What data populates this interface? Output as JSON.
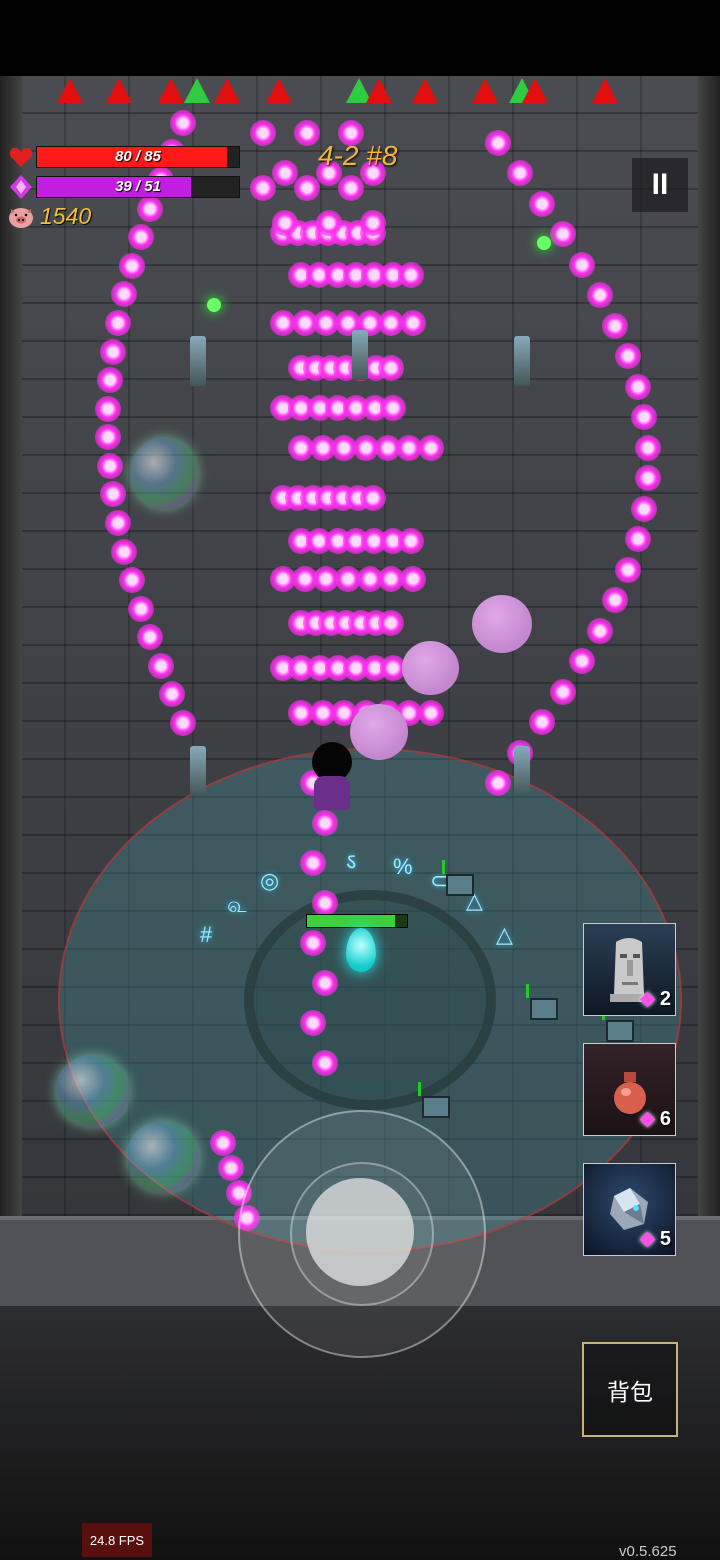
{
  "hud": {
    "hp": {
      "current": 80,
      "max": 85,
      "text": "80 / 85",
      "color": "#ff1a1a"
    },
    "mana": {
      "current": 39,
      "max": 51,
      "text": "39 / 51",
      "color": "#c21ee0"
    },
    "coins": "1540"
  },
  "level": {
    "label": "4-2 #8"
  },
  "pause": {
    "label": "II"
  },
  "skills": [
    {
      "name": "moai-statue",
      "cost": "2"
    },
    {
      "name": "red-potion-vase",
      "cost": "6"
    },
    {
      "name": "crystal-orb",
      "cost": "5"
    }
  ],
  "backpack": {
    "label": "背包"
  },
  "debug": {
    "fps": "24.8 FPS",
    "version": "v0.5.625"
  },
  "colors": {
    "bullet": "#ff2ef0",
    "accent_gold": "#f2b53a",
    "pet_hp": "#3cd03c"
  },
  "pet": {
    "hp_fraction": 0.88
  }
}
